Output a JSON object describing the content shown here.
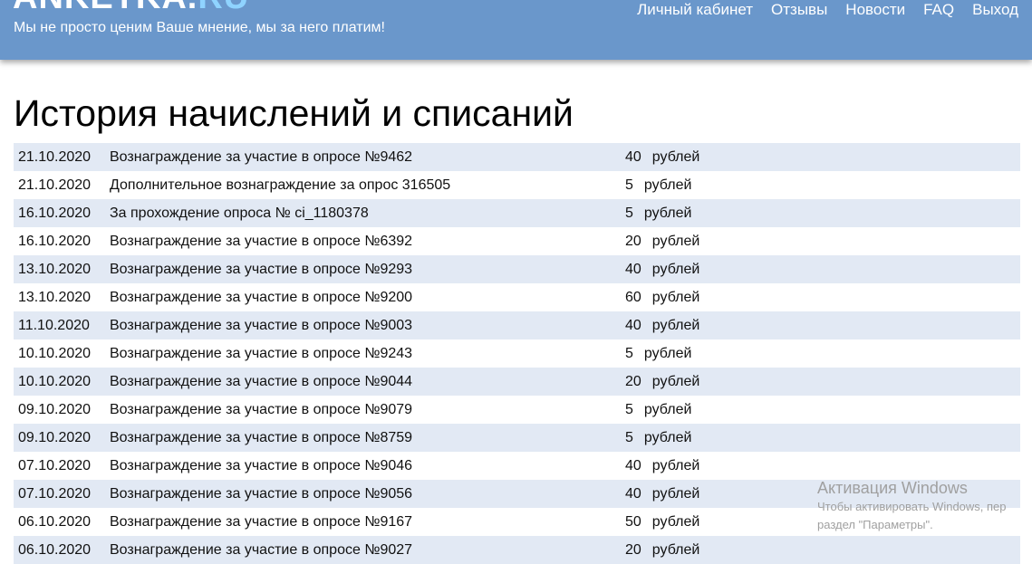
{
  "header": {
    "logo_main": "ANKETKA.",
    "logo_accent": "RU",
    "slogan": "Мы не просто ценим Ваше мнение, мы за него платим!",
    "nav": [
      "Личный кабинет",
      "Отзывы",
      "Новости",
      "FAQ",
      "Выход"
    ]
  },
  "page": {
    "title": "История начислений и списаний"
  },
  "transactions": [
    {
      "date": "21.10.2020",
      "description": "Вознаграждение за участие в опросе №9462",
      "amount": "40",
      "currency": "рублей"
    },
    {
      "date": "21.10.2020",
      "description": "Дополнительное вознаграждение за опрос 316505",
      "amount": "5",
      "currency": "рублей"
    },
    {
      "date": "16.10.2020",
      "description": "За прохождение опроса № ci_1180378",
      "amount": "5",
      "currency": "рублей"
    },
    {
      "date": "16.10.2020",
      "description": "Вознаграждение за участие в опросе №6392",
      "amount": "20",
      "currency": "рублей"
    },
    {
      "date": "13.10.2020",
      "description": "Вознаграждение за участие в опросе №9293",
      "amount": "40",
      "currency": "рублей"
    },
    {
      "date": "13.10.2020",
      "description": "Вознаграждение за участие в опросе №9200",
      "amount": "60",
      "currency": "рублей"
    },
    {
      "date": "11.10.2020",
      "description": "Вознаграждение за участие в опросе №9003",
      "amount": "40",
      "currency": "рублей"
    },
    {
      "date": "10.10.2020",
      "description": "Вознаграждение за участие в опросе №9243",
      "amount": "5",
      "currency": "рублей"
    },
    {
      "date": "10.10.2020",
      "description": "Вознаграждение за участие в опросе №9044",
      "amount": "20",
      "currency": "рублей"
    },
    {
      "date": "09.10.2020",
      "description": "Вознаграждение за участие в опросе №9079",
      "amount": "5",
      "currency": "рублей"
    },
    {
      "date": "09.10.2020",
      "description": "Вознаграждение за участие в опросе №8759",
      "amount": "5",
      "currency": "рублей"
    },
    {
      "date": "07.10.2020",
      "description": "Вознаграждение за участие в опросе №9046",
      "amount": "40",
      "currency": "рублей"
    },
    {
      "date": "07.10.2020",
      "description": "Вознаграждение за участие в опросе №9056",
      "amount": "40",
      "currency": "рублей"
    },
    {
      "date": "06.10.2020",
      "description": "Вознаграждение за участие в опросе №9167",
      "amount": "50",
      "currency": "рублей"
    },
    {
      "date": "06.10.2020",
      "description": "Вознаграждение за участие в опросе №9027",
      "amount": "20",
      "currency": "рублей"
    }
  ],
  "watermark": {
    "title": "Активация Windows",
    "line1": "Чтобы активировать Windows, пер",
    "line2": "раздел \"Параметры\"."
  },
  "colors": {
    "header_bg": "#6a97cb",
    "row_alt_bg": "#e2e9f4"
  }
}
